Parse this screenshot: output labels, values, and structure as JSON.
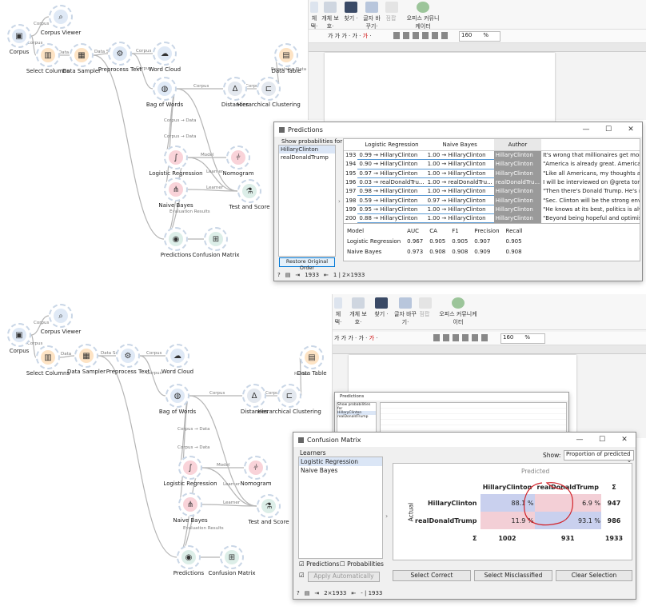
{
  "workflow_top": {
    "nodes": [
      {
        "id": "corpus",
        "label": "Corpus",
        "icon": "corpus-icon",
        "color": "#dfe9f6"
      },
      {
        "id": "corpus_viewer",
        "label": "Corpus Viewer",
        "icon": "magnifier-icon",
        "color": "#dfe9f6"
      },
      {
        "id": "select_columns",
        "label": "Select Columns",
        "icon": "columns-icon",
        "color": "#fde3c4"
      },
      {
        "id": "data_sampler",
        "label": "Data Sampler",
        "icon": "sampler-icon",
        "color": "#fde3c4"
      },
      {
        "id": "preprocess_text",
        "label": "Preprocess Text",
        "icon": "gears-icon",
        "color": "#dfe9f6"
      },
      {
        "id": "word_cloud",
        "label": "Word Cloud",
        "icon": "cloud-icon",
        "color": "#dfe9f6"
      },
      {
        "id": "data_table",
        "label": "Data Table",
        "icon": "table-icon",
        "color": "#fde3c4"
      },
      {
        "id": "bag_of_words",
        "label": "Bag of Words",
        "icon": "bag-icon",
        "color": "#dfe9f6"
      },
      {
        "id": "distances",
        "label": "Distances",
        "icon": "delta-icon",
        "color": "#e3e8ef"
      },
      {
        "id": "hier_clust",
        "label": "Hierarchical Clustering",
        "icon": "dendrogram-icon",
        "color": "#e3e8ef"
      },
      {
        "id": "logreg",
        "label": "Logistic Regression",
        "icon": "sigmoid-icon",
        "color": "#f9d3d9"
      },
      {
        "id": "nomogram",
        "label": "Nomogram",
        "icon": "nomogram-icon",
        "color": "#f9d3d9"
      },
      {
        "id": "naive_bayes",
        "label": "Naive Bayes",
        "icon": "bayes-icon",
        "color": "#f9d3d9"
      },
      {
        "id": "test_score",
        "label": "Test and Score",
        "icon": "flask-icon",
        "color": "#dceee8"
      },
      {
        "id": "predictions",
        "label": "Predictions",
        "icon": "crystal-ball-icon",
        "color": "#dceee8"
      },
      {
        "id": "confusion_matrix",
        "label": "Confusion Matrix",
        "icon": "matrix-icon",
        "color": "#dceee8"
      }
    ],
    "links": [
      "Corpus",
      "Corpus",
      "Data",
      "Data Sample",
      "Corpus",
      "Corpus",
      "Corpus",
      "Corpus → Data",
      "Remaining Data → Data",
      "Corpus → Data",
      "Corpus → Data",
      "Model",
      "Learner",
      "Learner",
      "Evaluation Results"
    ]
  },
  "workflow_bottom": {
    "nodes": [
      {
        "id": "corpus",
        "label": "Corpus",
        "icon": "corpus-icon",
        "color": "#dfe9f6"
      },
      {
        "id": "corpus_viewer",
        "label": "Corpus Viewer",
        "icon": "magnifier-icon",
        "color": "#dfe9f6"
      },
      {
        "id": "select_columns",
        "label": "Select Columns",
        "icon": "columns-icon",
        "color": "#fde3c4"
      },
      {
        "id": "data_sampler",
        "label": "Data Sampler",
        "icon": "sampler-icon",
        "color": "#fde3c4"
      },
      {
        "id": "preprocess_text",
        "label": "Preprocess Text",
        "icon": "gears-icon",
        "color": "#dfe9f6"
      },
      {
        "id": "word_cloud",
        "label": "Word Cloud",
        "icon": "cloud-icon",
        "color": "#dfe9f6"
      },
      {
        "id": "data_table",
        "label": "Data Table",
        "icon": "table-icon",
        "color": "#fde3c4"
      },
      {
        "id": "bag_of_words",
        "label": "Bag of Words",
        "icon": "bag-icon",
        "color": "#dfe9f6"
      },
      {
        "id": "distances",
        "label": "Distances",
        "icon": "delta-icon",
        "color": "#e3e8ef"
      },
      {
        "id": "hier_clust",
        "label": "Hierarchical Clustering",
        "icon": "dendrogram-icon",
        "color": "#e3e8ef"
      },
      {
        "id": "logreg",
        "label": "Logistic Regression",
        "icon": "sigmoid-icon",
        "color": "#f9d3d9"
      },
      {
        "id": "nomogram",
        "label": "Nomogram",
        "icon": "nomogram-icon",
        "color": "#f9d3d9"
      },
      {
        "id": "naive_bayes",
        "label": "Naive Bayes",
        "icon": "bayes-icon",
        "color": "#f9d3d9"
      },
      {
        "id": "test_score",
        "label": "Test and Score",
        "icon": "flask-icon",
        "color": "#dceee8"
      },
      {
        "id": "predictions",
        "label": "Predictions",
        "icon": "crystal-ball-icon",
        "color": "#dceee8"
      },
      {
        "id": "confusion_matrix",
        "label": "Confusion Matrix",
        "icon": "matrix-icon",
        "color": "#dceee8"
      }
    ]
  },
  "ribbon_top": {
    "b1": "체\n택·",
    "b2": "개체\n보호·",
    "b3": "찾기\n·",
    "b4": "글자\n바꾸기·",
    "b5": "점팝",
    "b6": "오피스\n커뮤니케이터",
    "zoom": "160",
    "unit": "%"
  },
  "ribbon_bottom": {
    "b1": "체\n택·",
    "b2": "개체\n보호·",
    "b3": "찾기\n·",
    "b4": "글자\n바꾸기·",
    "b5": "점팝",
    "b6": "오피스\n커뮤니케이터",
    "zoom": "160",
    "unit": "%"
  },
  "predictions": {
    "title": "Predictions",
    "show_probabilities_label": "Show probabilities for",
    "classes": [
      "HillaryClinton",
      "realDonaldTrump"
    ],
    "restore_button": "Restore Original Order",
    "col_headers": [
      "Logistic Regression",
      "Naive Bayes",
      "Author"
    ],
    "rows": [
      {
        "n": "193",
        "lr": "0.99 → HillaryClinton",
        "nb": "1.00 → HillaryClinton",
        "author": "HillaryClinton",
        "text": "It's wrong that millionaires get more tax cu"
      },
      {
        "n": "194",
        "lr": "0.90 → HillaryClinton",
        "nb": "1.00 → HillaryClinton",
        "author": "HillaryClinton",
        "text": "\"America is already great. America is alread"
      },
      {
        "n": "195",
        "lr": "0.97 → HillaryClinton",
        "nb": "1.00 → HillaryClinton",
        "author": "HillaryClinton",
        "text": "\"Like all Americans, my thoughts are with th"
      },
      {
        "n": "196",
        "lr": "0.03 → realDonaldTru...",
        "nb": "1.00 → realDonaldTru...",
        "author": "realDonaldTru...",
        "text": "I will be interviewed on @greta tonight at ."
      },
      {
        "n": "197",
        "lr": "0.98 → HillaryClinton",
        "nb": "1.00 → HillaryClinton",
        "author": "HillaryClinton",
        "text": "\"Then there's Donald Trump. He's not really"
      },
      {
        "n": "198",
        "lr": "0.59 → HillaryClinton",
        "nb": "0.97 → HillaryClinton",
        "author": "HillaryClinton",
        "text": "\"Sec. Clinton will be the strong environmer"
      },
      {
        "n": "199",
        "lr": "0.95 → HillaryClinton",
        "nb": "1.00 → HillaryClinton",
        "author": "HillaryClinton",
        "text": "\"He knows at its best, politics is always a m"
      },
      {
        "n": "200",
        "lr": "0.88 → HillaryClinton",
        "nb": "1.00 → HillaryClinton",
        "author": "HillaryClinton",
        "text": "\"Beyond being hopeful and optimistic, I'm d"
      }
    ],
    "metrics_headers": [
      "Model",
      "AUC",
      "CA",
      "F1",
      "Precision",
      "Recall"
    ],
    "metrics": [
      [
        "Logistic Regression",
        "0.967",
        "0.905",
        "0.905",
        "0.907",
        "0.905"
      ],
      [
        "Naive Bayes",
        "0.973",
        "0.908",
        "0.908",
        "0.909",
        "0.908"
      ]
    ],
    "status_in": "1933",
    "status_out": "1 | 2×1933"
  },
  "confusion": {
    "title": "Confusion Matrix",
    "learners_label": "Learners",
    "learners": [
      "Logistic Regression",
      "Naive Bayes"
    ],
    "show_label": "Show:",
    "show_value": "Proportion of predicted",
    "predicted_label": "Predicted",
    "actual_label": "Actual",
    "col_headers": [
      "HillaryClinton",
      "realDonaldTrump",
      "Σ"
    ],
    "row_headers": [
      "HillaryClinton",
      "realDonaldTrump",
      "Σ"
    ],
    "cells": [
      [
        "88.1 %",
        "6.9 %",
        "947"
      ],
      [
        "11.9 %",
        "93.1 %",
        "986"
      ],
      [
        "1002",
        "931",
        "1933"
      ]
    ],
    "predictions_cb": "Predictions",
    "probabilities_cb": "Probabilities",
    "apply_label": "Apply Automatically",
    "select_correct": "Select Correct",
    "select_misclassified": "Select Misclassified",
    "clear_selection": "Clear Selection",
    "status_in": "2×1933",
    "status_out": "- | 1933"
  },
  "mini_predictions": {
    "title": "Predictions",
    "show_probabilities_label": "Show probabilities for",
    "classes": [
      "HillaryClinton",
      "realDonaldTrump"
    ]
  }
}
